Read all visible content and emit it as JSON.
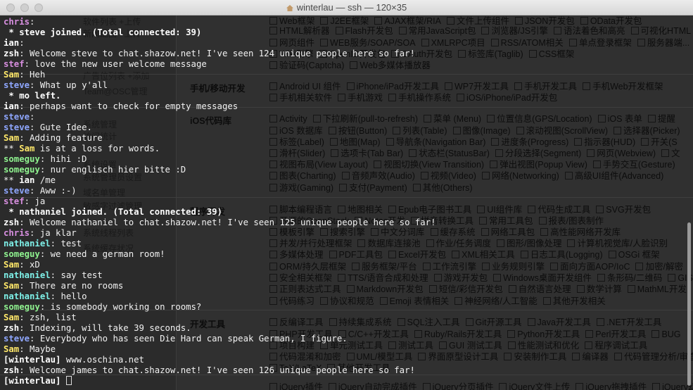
{
  "window": {
    "title": "winterlau — ssh — 120×35"
  },
  "colors": {
    "chris": "#d88fe0",
    "steve": "#8fa7ff",
    "ian": "#ffffff",
    "zsh": "#ffffff",
    "stef": "#d88fe0",
    "Sam": "#ffe86a",
    "someguy": "#8ff28f",
    "nathaniel": "#7ef0e8",
    "system": "#ffffff",
    "winterlau": "#ffffff",
    "text": "#f2f2f2"
  },
  "terminal": {
    "lines": [
      {
        "nick": "chris",
        "sep": ":",
        "text": ""
      },
      {
        "text": " * steve joined. (Total connected: 39)",
        "style": "system"
      },
      {
        "nick": "ian",
        "sep": ":",
        "text": ""
      },
      {
        "nick": "zsh",
        "sep": ":",
        "text": " Welcome steve to chat.shazow.net! I've seen 124 unique people here so far!"
      },
      {
        "nick": "stef",
        "sep": ":",
        "text": " love the new user welcome message"
      },
      {
        "nick": "Sam",
        "sep": ":",
        "text": " Heh"
      },
      {
        "nick": "steve",
        "sep": ":",
        "text": " What up y'all"
      },
      {
        "text": " * mo left.",
        "style": "system"
      },
      {
        "nick": "ian",
        "sep": ":",
        "text": " perhaps want to check for empty messages"
      },
      {
        "nick": "steve",
        "sep": ":",
        "text": ""
      },
      {
        "nick": "steve",
        "sep": ":",
        "text": " Gute Idee."
      },
      {
        "nick": "Sam",
        "sep": ":",
        "text": " Adding feature"
      },
      {
        "prefix": "** ",
        "nick": "Sam",
        "sep": "",
        "text": " is at a loss for words."
      },
      {
        "nick": "someguy",
        "sep": ":",
        "text": " hihi :D"
      },
      {
        "nick": "someguy",
        "sep": ":",
        "text": " nur englisch hier bitte :D"
      },
      {
        "prefix": "** ",
        "nick": "ian",
        "sep": "",
        "text": " /me"
      },
      {
        "nick": "steve",
        "sep": ":",
        "text": " Aww :-)"
      },
      {
        "nick": "stef",
        "sep": ":",
        "text": " ja"
      },
      {
        "text": " * nathaniel joined. (Total connected: 39)",
        "style": "system"
      },
      {
        "nick": "zsh",
        "sep": ":",
        "text": " Welcome nathaniel to chat.shazow.net! I've seen 125 unique people here so far!"
      },
      {
        "nick": "chris",
        "sep": ":",
        "text": " ja klar"
      },
      {
        "nick": "nathaniel",
        "sep": ":",
        "text": " test"
      },
      {
        "nick": "someguy",
        "sep": ":",
        "text": " we need a german room!"
      },
      {
        "nick": "Sam",
        "sep": ":",
        "text": " xD"
      },
      {
        "nick": "nathaniel",
        "sep": ":",
        "text": " say test"
      },
      {
        "nick": "Sam",
        "sep": ":",
        "text": " There are no rooms"
      },
      {
        "nick": "nathaniel",
        "sep": ":",
        "text": " hello"
      },
      {
        "nick": "someguy",
        "sep": ":",
        "text": " is somebody working on rooms?"
      },
      {
        "nick": "Sam",
        "sep": ":",
        "text": " zsh, list"
      },
      {
        "nick": "zsh",
        "sep": ":",
        "text": " Indexing, will take 39 seconds."
      },
      {
        "nick": "steve",
        "sep": ":",
        "text": " Everybody who has seen Die Hard can speak German, I figure."
      },
      {
        "nick": "Sam",
        "sep": ":",
        "text": " Maybe"
      },
      {
        "nick": "[winterlau]",
        "sep": "",
        "text": " www.oschina.net",
        "style": "self"
      },
      {
        "nick": "zsh",
        "sep": ":",
        "text": " Welcome james to chat.shazow.net! I've seen 126 unique people here so far!"
      }
    ],
    "prompt": "[winterlau]"
  },
  "background": {
    "sidebar": [
      "软件列表 +上传",
      "新闻配图 +上传",
      "广告位列表 +添加",
      "Team@OSC管理",
      "系统管理",
      "访问统计",
      "系统设置",
      "系统管理员设置",
      "域名单管理",
      "敏感字过滤管理",
      "系统线程列表",
      "系统缓存状况"
    ],
    "rows": [
      {
        "cat": "",
        "items": [
          "Web框架",
          "J2EE框架",
          "AJAX框架/RIA",
          "文件上传组件",
          "JSON开发包",
          "OData开发包"
        ]
      },
      {
        "cat": "",
        "items": [
          "HTML解析器",
          "Flash开发包",
          "常用JavaScript包",
          "浏览器/JS引擎",
          "语法着色和高亮",
          "可视化HTML"
        ]
      },
      {
        "cat": "",
        "items": [
          "网页组件",
          "WEB服务/SOAP/SOA",
          "XMLRPC项目",
          "RSS/ATOM相关",
          "单点登录框架",
          "服务器端..."
        ]
      },
      {
        "cat": "",
        "items": [
          "Wiki引擎",
          "OpenID开发包",
          "OAuth开发包",
          "标签库(Taglib)",
          "CSS框架"
        ]
      },
      {
        "cat": "",
        "items": [
          "验证码(Captcha)",
          "Web多媒体播放器"
        ]
      },
      {
        "cat": "手机/移动开发",
        "items": [
          "Android UI 组件",
          "iPhone/iPad开发工具",
          "WP7开发工具",
          "手机开发工具",
          "手机Web开发框架"
        ]
      },
      {
        "cat": "",
        "items": [
          "手机相关软件",
          "手机游戏",
          "手机操作系统",
          "iOS/iPhone/iPad开发包"
        ]
      },
      {
        "cat": "iOS代码库",
        "items": [
          "Activity",
          "下拉刷新(pull-to-refresh)",
          "菜单 (Menu)",
          "位置信息(GPS/Location)",
          "iOS 表单",
          "提醒"
        ]
      },
      {
        "cat": "",
        "items": [
          "iOS 数据库",
          "按钮(Button)",
          "列表(Table)",
          "图像(Image)",
          "滚动视图(ScrollView)",
          "选择器(Picker)"
        ]
      },
      {
        "cat": "",
        "items": [
          "标签(Label)",
          "地图(Map)",
          "导航条(Navigation Bar)",
          "进度条(Progress)",
          "指示器(HUD)",
          "开关(S"
        ]
      },
      {
        "cat": "",
        "items": [
          "滑杆(Slider)",
          "选项卡(Tab Bar)",
          "状态栏(StatusBar)",
          "分段选择(Segment)",
          "网页(Webview)",
          "文"
        ]
      },
      {
        "cat": "",
        "items": [
          "视图布局(View Layout)",
          "视图切换(View Transition)",
          "弹出视图(Popup View)",
          "手势交互(Gesture)"
        ]
      },
      {
        "cat": "",
        "items": [
          "图表(Charting)",
          "音频声效(Audio)",
          "视频(Video)",
          "网络(Networking)",
          "高级UI组件(Advanced)"
        ]
      },
      {
        "cat": "",
        "items": [
          "游戏(Gaming)",
          "支付(Payment)",
          "其他(Others)"
        ]
      },
      {
        "cat": "程序开发",
        "items": [
          "脚本编程语言",
          "地图相关",
          "Epub电子图书工具",
          "UI组件库",
          "代码生成工具",
          "SVG开发包"
        ]
      },
      {
        "cat": "",
        "items": [
          "开源的OpenStack",
          "Notes开发",
          "拼音转换工具",
          "常用工具包",
          "报表/图表制作"
        ]
      },
      {
        "cat": "",
        "items": [
          "模板引擎",
          "搜索引擎",
          "中文分词库",
          "缓存系统",
          "网络工具包",
          "高性能网络开发库"
        ]
      },
      {
        "cat": "",
        "items": [
          "并发/并行处理框架",
          "数据库连接池",
          "作业/任务调度",
          "图形/图像处理",
          "计算机视觉库/人脸识别"
        ]
      },
      {
        "cat": "",
        "items": [
          "多媒体处理",
          "PDF工具包",
          "Excel开发包",
          "XML相关工具",
          "日志工具(Logging)",
          "OSGi 框架"
        ]
      },
      {
        "cat": "",
        "items": [
          "ORM/持久层框架",
          "服务框架/平台",
          "工作流引擎",
          "业务规则引擎",
          "面向方面AOP/IoC",
          "加密/解密"
        ]
      },
      {
        "cat": "",
        "items": [
          "安全相关框架",
          "TTS/语音合成和处理",
          "游戏开发包",
          "Windows桌面开发组件",
          "条形码/二维码",
          "GIS"
        ]
      },
      {
        "cat": "",
        "items": [
          "正则表达式工具",
          "Markdown开发包",
          "短信/彩信开发包",
          "自然语言处理",
          "数学计算",
          "MathML开发"
        ]
      },
      {
        "cat": "",
        "items": [
          "代码练习",
          "协议和规范",
          "Emoji 表情相关",
          "神经网络/人工智能",
          "其他开发相关"
        ]
      },
      {
        "cat": "开发工具",
        "items": [
          "反编译工具",
          "持续集成系统",
          "SQL注入工具",
          "Git开源工具",
          "Java开发工具",
          ".NET开发工具"
        ]
      },
      {
        "cat": "",
        "items": [
          "PHP开发工具",
          "C/C++开发工具",
          "Ruby/Rails开发工具",
          "Python开发工具",
          "Perl开发工具",
          "BUG"
        ]
      },
      {
        "cat": "",
        "items": [
          "项目构建",
          "单元测试工具",
          "测试工具",
          "GUI 测试工具",
          "性能测试和优化",
          "程序调试工具"
        ]
      },
      {
        "cat": "",
        "items": [
          "代码混淆和加密",
          "UML/模型工具",
          "界面原型设计工具",
          "安装制作工具",
          "编译器",
          "代码管理分析/审查"
        ]
      },
      {
        "cat": "",
        "items": [
          "TeX/LaTeX",
          "其他开发工具"
        ]
      },
      {
        "cat": "",
        "items": [
          "jQuery插件",
          "jQuery自动完成插件",
          "jQuery分页插件",
          "jQuery文件上传",
          "jQuery拖拽插件",
          "jQuery幻灯"
        ]
      }
    ]
  }
}
